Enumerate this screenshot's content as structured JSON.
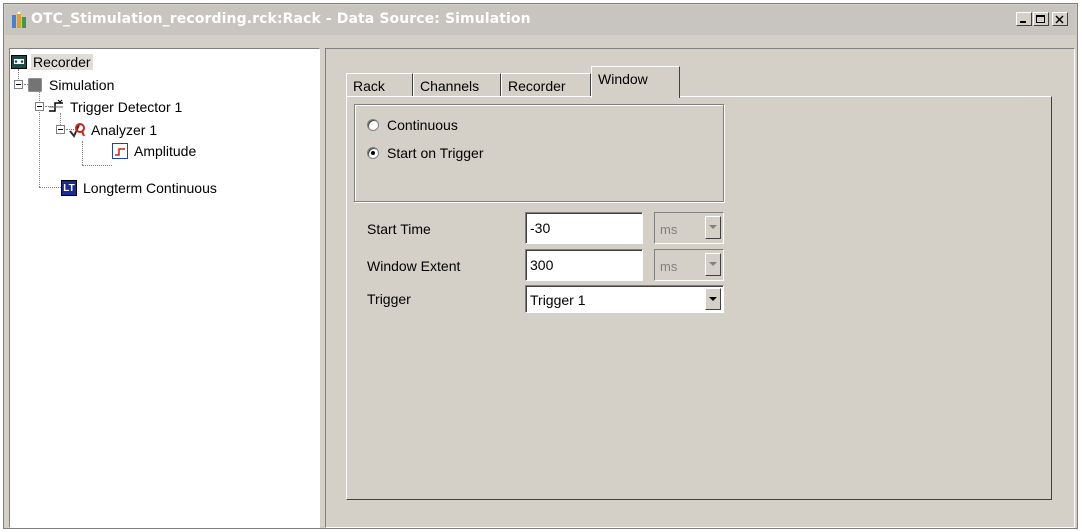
{
  "window": {
    "title": "OTC_Stimulation_recording.rck:Rack - Data Source: Simulation",
    "controls": [
      "minimize-icon",
      "maximize-icon",
      "close-icon"
    ]
  },
  "tree": {
    "items": [
      {
        "label": "Recorder",
        "icon": "recorder-icon",
        "selected": true
      },
      {
        "label": "Simulation",
        "icon": "simulation-icon"
      },
      {
        "label": "Trigger Detector 1",
        "icon": "trigger-detector-icon"
      },
      {
        "label": "Analyzer 1",
        "icon": "analyzer-icon"
      },
      {
        "label": "Amplitude",
        "icon": "amplitude-icon"
      },
      {
        "label": "Longterm Continuous",
        "icon": "longterm-icon",
        "badge": "LT"
      }
    ]
  },
  "tabs": [
    {
      "label": "Rack"
    },
    {
      "label": "Channels"
    },
    {
      "label": "Recorder"
    },
    {
      "label": "Window",
      "active": true
    }
  ],
  "mode": {
    "options": [
      {
        "label": "Continuous",
        "selected": false
      },
      {
        "label": "Start on Trigger",
        "selected": true
      }
    ]
  },
  "form": {
    "start_time": {
      "label": "Start Time",
      "value": "-30",
      "unit": "ms"
    },
    "window_extent": {
      "label": "Window Extent",
      "value": "300",
      "unit": "ms"
    },
    "trigger": {
      "label": "Trigger",
      "value": "Trigger 1"
    }
  },
  "colors": {
    "face": "#d4d0c8",
    "titlebar": "#c8c4c0",
    "selection": "#e0ddd8"
  }
}
